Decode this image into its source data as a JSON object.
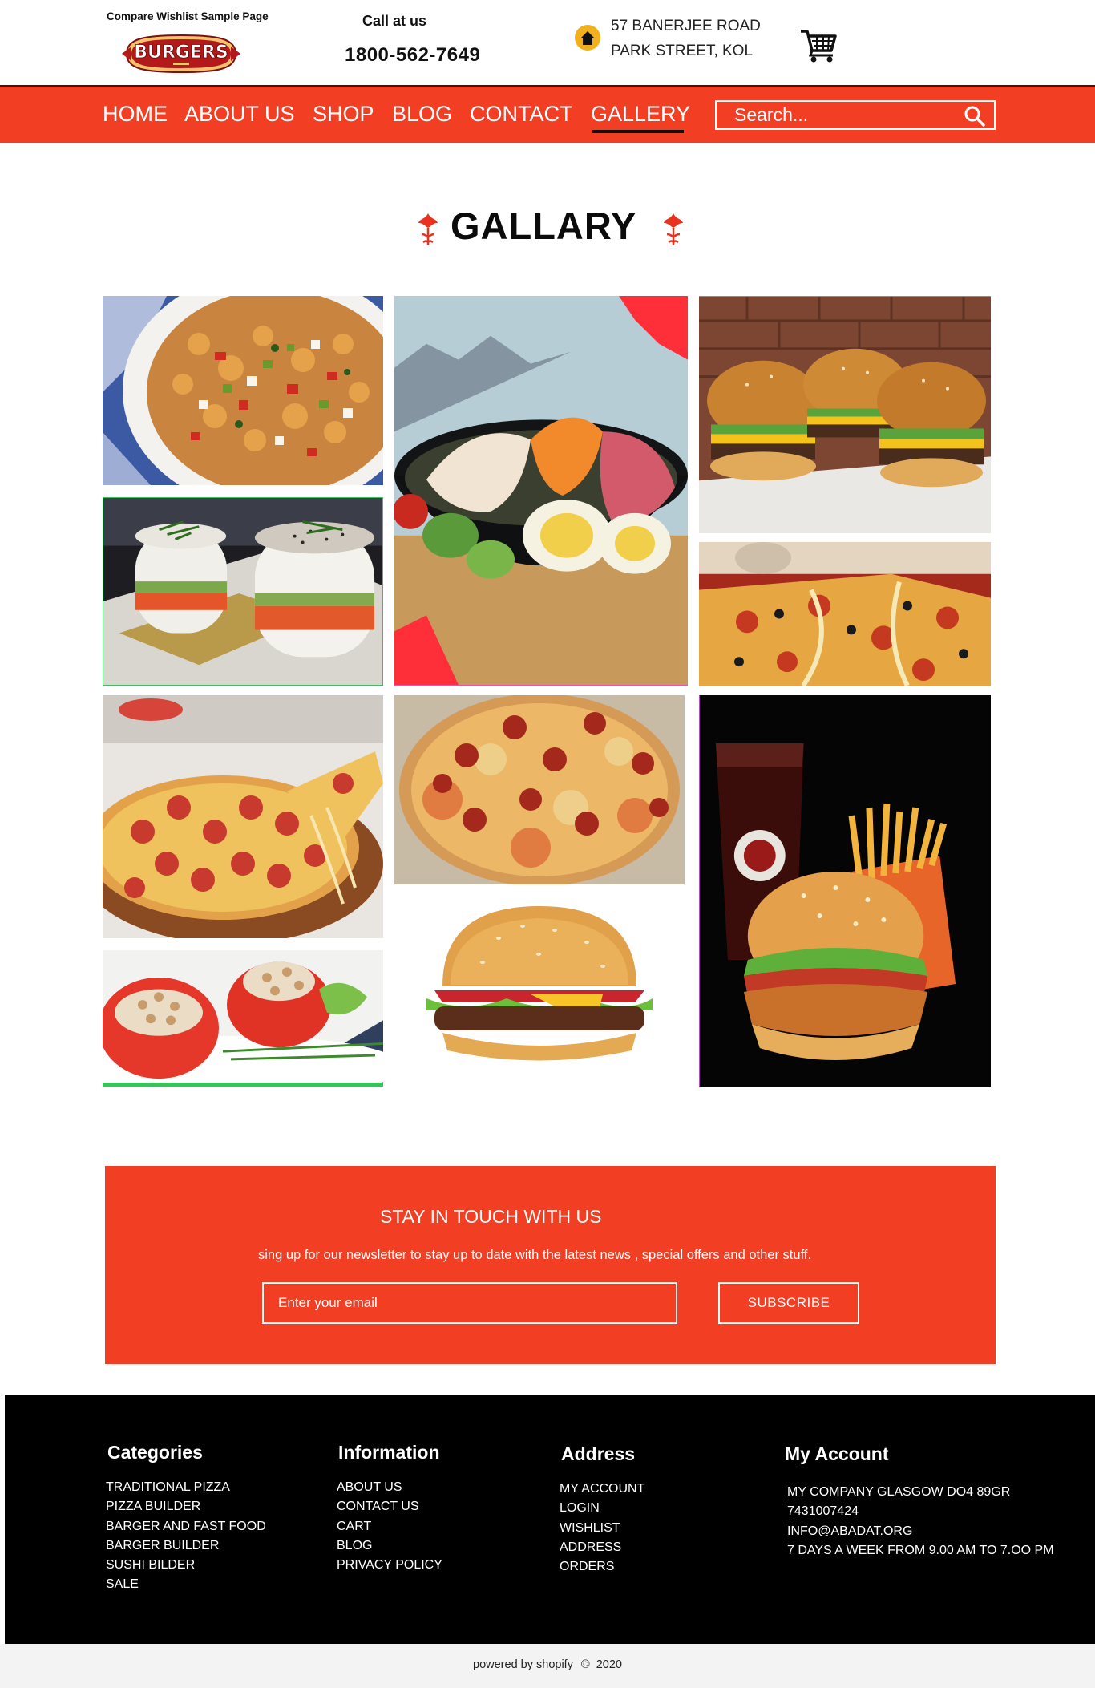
{
  "header": {
    "sample_link": "Compare Wishlist Sample Page",
    "logo_text": "BURGERS",
    "call_label": "Call at us",
    "phone": "1800-562-7649",
    "address_line1": "57 BANERJEE ROAD",
    "address_line2": "PARK STREET, KOL",
    "icons": [
      "home-icon",
      "cart-icon"
    ]
  },
  "nav": {
    "items": [
      "HOME",
      "ABOUT US",
      "SHOP",
      "BLOG",
      "CONTACT",
      "GALLERY"
    ],
    "active": "GALLERY",
    "search_placeholder": "Search..."
  },
  "gallery": {
    "title": "GALLARY",
    "images": [
      "pasta-salad",
      "sushi-rice-stacks",
      "cobb-salad-bowl",
      "slider-burgers",
      "pizza-slices",
      "pepperoni-pizza-pull",
      "pepperoni-pizza-box",
      "stuffed-tomatoes",
      "classic-burger",
      "burger-fries-drink-combo"
    ]
  },
  "newsletter": {
    "title": "STAY IN TOUCH WITH US",
    "subtitle": "sing up for our newsletter to stay up to date with the latest news , special offers and other stuff.",
    "email_placeholder": "Enter your email",
    "button": "SUBSCRIBE"
  },
  "footer": {
    "categories": {
      "title": "Categories",
      "items": [
        "TRADITIONAL PIZZA",
        "PIZZA BUILDER",
        "BARGER AND FAST FOOD",
        "BARGER BUILDER",
        "SUSHI BILDER",
        "SALE"
      ]
    },
    "information": {
      "title": "Information",
      "items": [
        "ABOUT US",
        "CONTACT US",
        "CART",
        "BLOG",
        "PRIVACY POLICY"
      ]
    },
    "address": {
      "title": "Address",
      "items": [
        "MY ACCOUNT",
        "LOGIN",
        "WISHLIST",
        "ADDRESS",
        "ORDERS"
      ]
    },
    "account": {
      "title": "My Account",
      "items": [
        "MY COMPANY GLASGOW DO4 89GR",
        "7431007424",
        "INFO@ABADAT.ORG",
        "7 DAYS A WEEK FROM 9.00 AM TO 7.OO PM"
      ]
    },
    "copyright_prefix": "powered by shopify",
    "copyright_symbol": "©",
    "copyright_year": "2020"
  },
  "colors": {
    "brand_red": "#f23e23",
    "footer_bg": "#000000",
    "logo_red": "#b3191b"
  }
}
